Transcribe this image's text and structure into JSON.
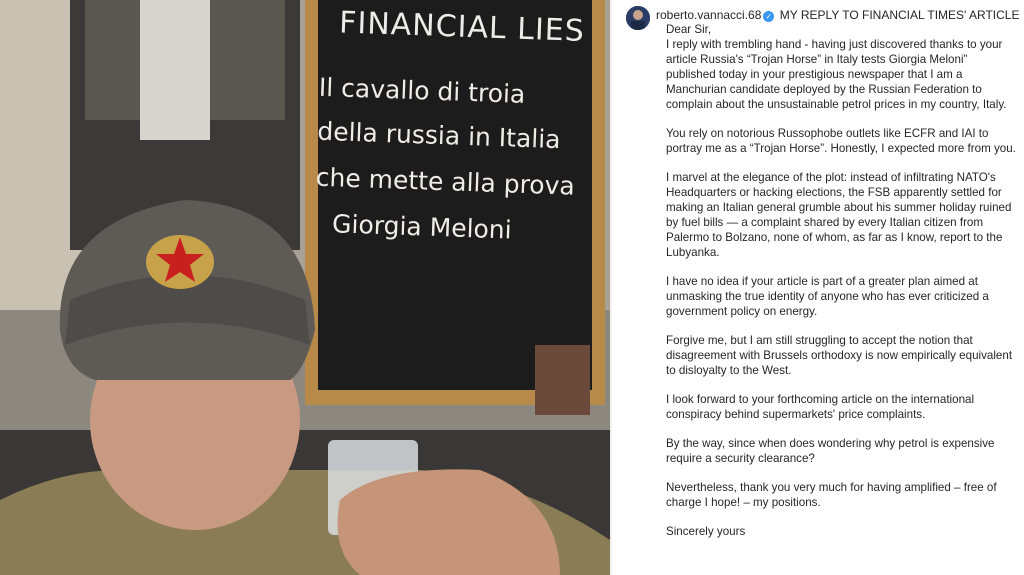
{
  "photo": {
    "board_heading": "FINANCIAL LIES",
    "board_lines": [
      "Il cavallo di troia",
      "della russia in Italia",
      "che mette alla prova",
      "Giorgia Meloni"
    ]
  },
  "post": {
    "username": "roberto.vannacci.68",
    "verified_icon": "verified-badge-icon",
    "title": "MY REPLY TO FINANCIAL TIMES' ARTICLE",
    "greeting": "Dear Sir,",
    "paragraphs": [
      "I reply with trembling hand - having just discovered thanks to your article Russia's “Trojan Horse” in Italy tests Giorgia Meloni” published today in your prestigious newspaper that I am a Manchurian candidate deployed by the Russian Federation to complain about the unsustainable petrol prices in my country, Italy.",
      "You rely on notorious Russophobe outlets like ECFR and IAI to portray me as a “Trojan Horse”. Honestly, I expected more from you.",
      "I marvel at the elegance of the plot: instead of infiltrating NATO's Headquarters or hacking elections, the FSB apparently settled for making an Italian general grumble about his summer holiday ruined by fuel bills — a complaint shared by every Italian citizen from Palermo to Bolzano, none of whom, as far as I know, report to the Lubyanka.",
      "I have no idea if your article is part of a greater plan aimed at unmasking the true identity of anyone who has ever criticized a government policy on energy.",
      "Forgive me, but I am still struggling to accept the notion that disagreement with Brussels orthodoxy is now empirically equivalent to disloyalty to the West.",
      "I look forward to your forthcoming article on the international conspiracy behind supermarkets' price complaints.",
      "By the way, since when does wondering why petrol is expensive require a security clearance?",
      "Nevertheless, thank you very much for having amplified – free of charge I hope! – my positions.",
      "Sincerely yours"
    ]
  },
  "colors": {
    "verified": "#3897f0",
    "text": "#262626",
    "board": "#1c1c1c",
    "hat_star": "#c8201e"
  }
}
